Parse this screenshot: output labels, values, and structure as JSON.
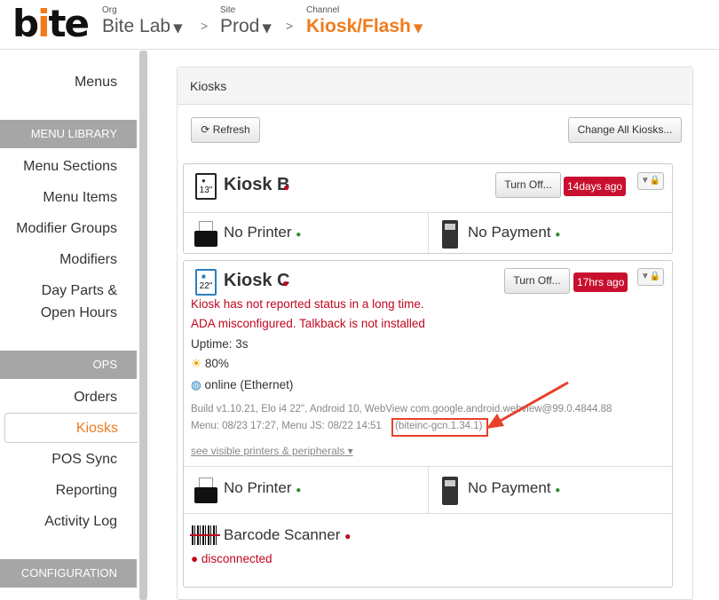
{
  "header": {
    "logo_prefix": "b",
    "logo_i": "i",
    "logo_suffix": "te",
    "org_label": "Org",
    "org_value": "Bite Lab",
    "site_label": "Site",
    "site_value": "Prod",
    "channel_label": "Channel",
    "channel_value": "Kiosk/Flash",
    "separator": ">",
    "caret": "▾"
  },
  "sidebar": {
    "menus": "Menus",
    "section_menu_library": "MENU LIBRARY",
    "menu_sections": "Menu Sections",
    "menu_items": "Menu Items",
    "modifier_groups": "Modifier Groups",
    "modifiers": "Modifiers",
    "day_parts_1": "Day Parts &",
    "day_parts_2": "Open Hours",
    "section_ops": "OPS",
    "orders": "Orders",
    "kiosks": "Kiosks",
    "pos_sync": "POS Sync",
    "reporting": "Reporting",
    "activity_log": "Activity Log",
    "section_configuration": "CONFIGURATION"
  },
  "panel": {
    "title": "Kiosks",
    "refresh_label": "Refresh",
    "change_all_label": "Change All Kiosks..."
  },
  "kiosk_b": {
    "device_size": "13\"",
    "name": "Kiosk B",
    "turn_off_label": "Turn Off...",
    "last_seen_badge": "14days ago",
    "printer_label": "No Printer",
    "payment_label": "No Payment"
  },
  "kiosk_c": {
    "device_size": "22\"",
    "name": "Kiosk C",
    "turn_off_label": "Turn Off...",
    "last_seen_badge": "17hrs ago",
    "error_1": "Kiosk has not reported status in a long time.",
    "error_2": "ADA misconfigured. Talkback is not installed",
    "uptime": "Uptime: 3s",
    "brightness": "80%",
    "network": "online (Ethernet)",
    "build_info": "Build v1.10.21, Elo i4 22\", Android 10, WebView com.google.android.webview@99.0.4844.88",
    "menu_info": "Menu: 08/23 17:27, Menu JS: 08/22 14:51",
    "version_tag": "(biteinc-gcn.1.34.1)",
    "peripherals_link": "see visible printers & peripherals",
    "printer_label": "No Printer",
    "payment_label": "No Payment",
    "scanner_label": "Barcode Scanner",
    "scanner_status": "disconnected"
  },
  "colors": {
    "accent": "#f07b1c",
    "danger": "#c8102e",
    "ok": "#2e8b2e",
    "annotation": "#e8412b"
  }
}
